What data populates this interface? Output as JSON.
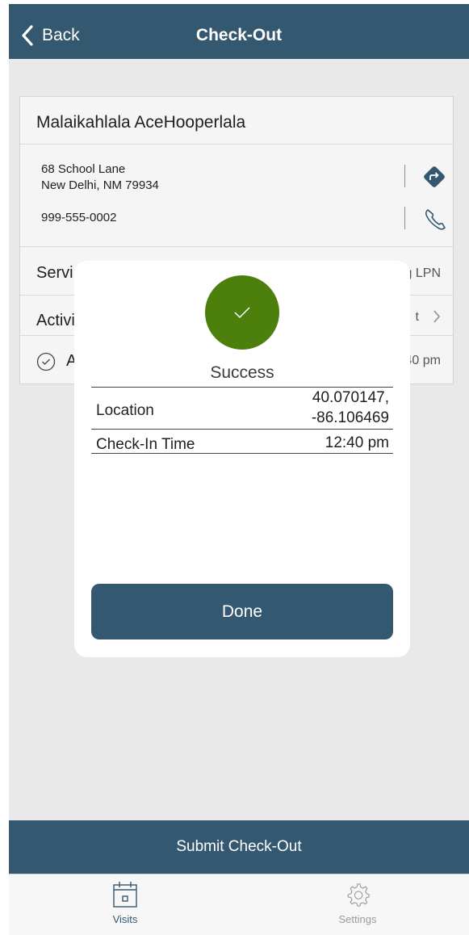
{
  "header": {
    "back_label": "Back",
    "title": "Check-Out"
  },
  "patient": {
    "name": "Malaikahlala AceHooperlala",
    "address_line1": "68 School Lane",
    "address_line2": "New Delhi, NM 79934",
    "phone": "999-555-0002"
  },
  "rows": {
    "service_label": "Servi",
    "service_value": "g LPN",
    "activities_label": "Activi",
    "activities_value": "t",
    "checkin_label": "A",
    "checkin_value": "40 pm"
  },
  "modal": {
    "status": "Success",
    "location_label": "Location",
    "location_lat": "40.070147,",
    "location_lon": "-86.106469",
    "checkin_label": "Check-In Time",
    "checkin_value": "12:40 pm",
    "done_label": "Done"
  },
  "submit_label": "Submit Check-Out",
  "tabs": [
    {
      "label": "Visits",
      "icon": "calendar-icon"
    },
    {
      "label": "Settings",
      "icon": "gear-icon"
    }
  ],
  "colors": {
    "primary": "#34586f",
    "success": "#4c7f0b",
    "background": "#e9e9e9",
    "card": "#f5f5f5"
  }
}
